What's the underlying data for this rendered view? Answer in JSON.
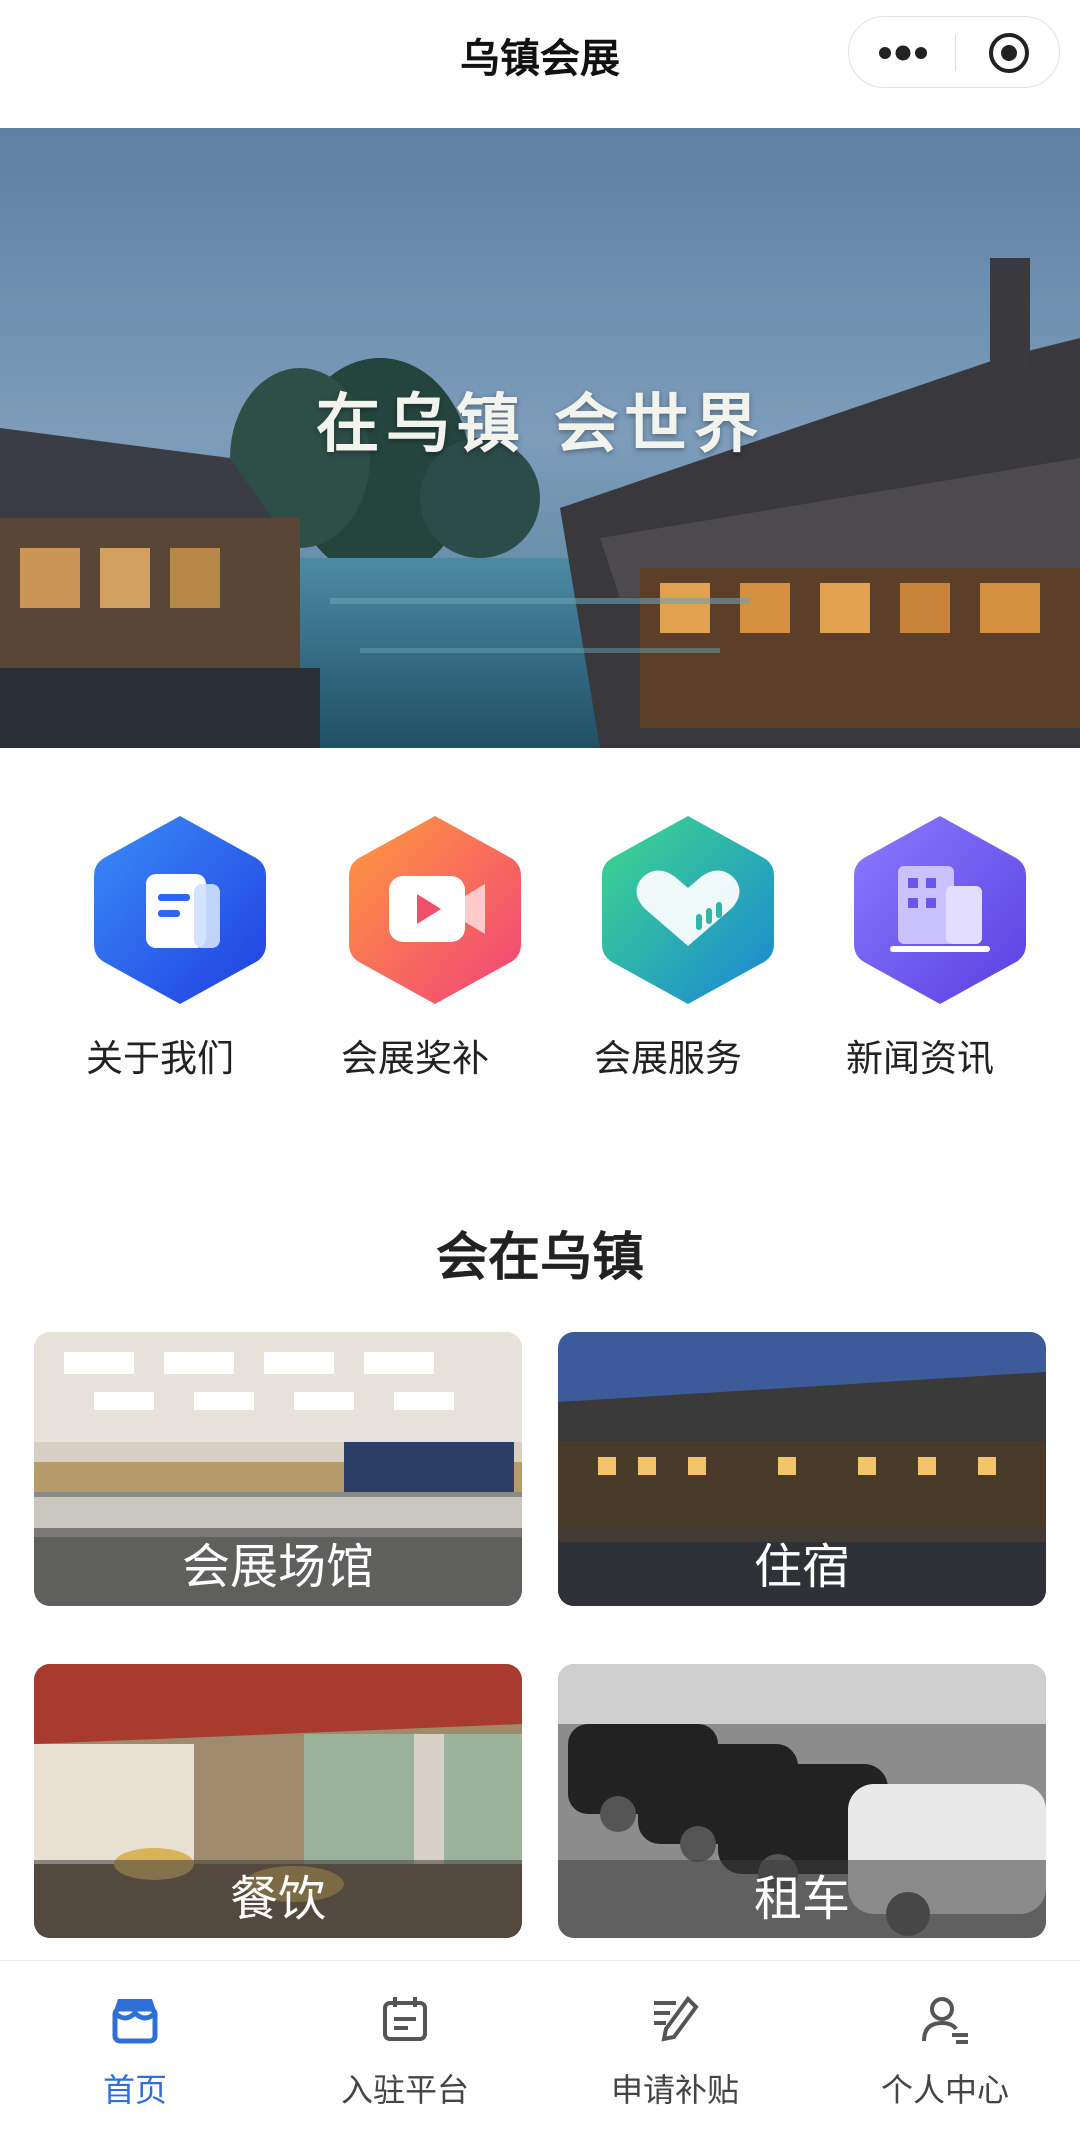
{
  "app": {
    "title": "乌镇会展"
  },
  "banner": {
    "slogan": "在乌镇 会世界"
  },
  "quick_links": [
    {
      "label": "关于我们",
      "icon": "document-icon"
    },
    {
      "label": "会展奖补",
      "icon": "video-play-icon"
    },
    {
      "label": "会展服务",
      "icon": "heart-hand-icon"
    },
    {
      "label": "新闻资讯",
      "icon": "building-icon"
    }
  ],
  "section": {
    "title": "会在乌镇"
  },
  "cards": [
    {
      "label": "会展场馆"
    },
    {
      "label": "住宿"
    },
    {
      "label": "餐饮"
    },
    {
      "label": "租车"
    }
  ],
  "tabbar": [
    {
      "label": "首页",
      "active": true
    },
    {
      "label": "入驻平台",
      "active": false
    },
    {
      "label": "申请补贴",
      "active": false
    },
    {
      "label": "个人中心",
      "active": false
    }
  ],
  "colors": {
    "accent": "#2f6fd8"
  }
}
